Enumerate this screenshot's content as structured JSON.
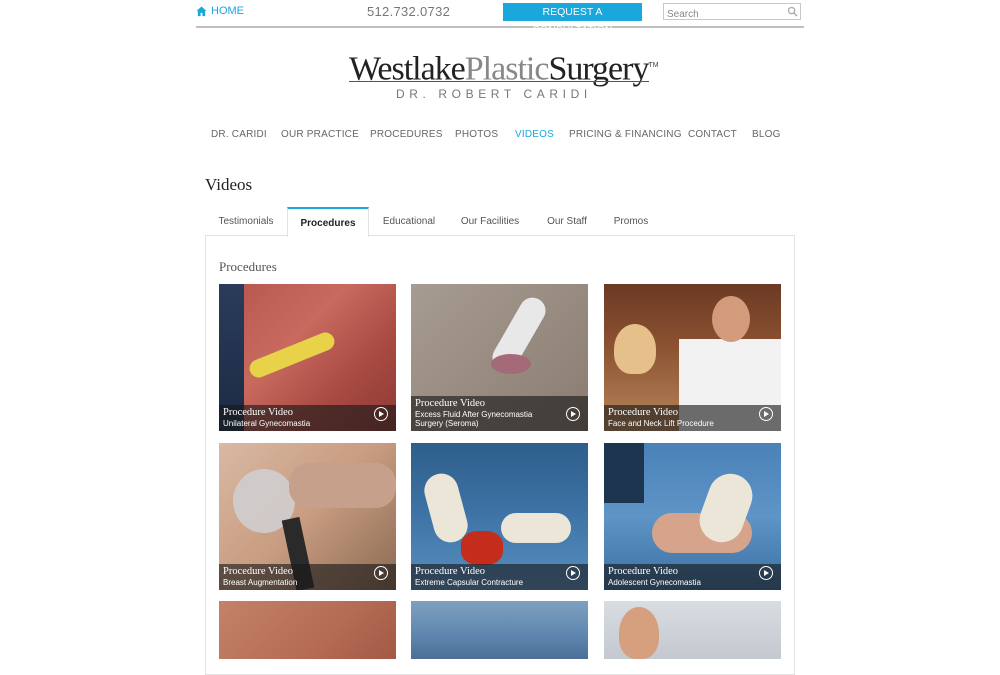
{
  "topbar": {
    "home_label": "HOME",
    "phone": "512.732.0732",
    "cta_label": "REQUEST A CONSULTATION",
    "search_placeholder": "Search"
  },
  "logo": {
    "part1": "Westlake",
    "part2": "Plastic",
    "part3": "Surgery",
    "tm": "TM",
    "subtitle": "DR. ROBERT CARIDI"
  },
  "nav": [
    "DR. CARIDI",
    "OUR PRACTICE",
    "PROCEDURES",
    "PHOTOS",
    "VIDEOS",
    "PRICING & FINANCING",
    "CONTACT",
    "BLOG"
  ],
  "nav_active": "VIDEOS",
  "page_title": "Videos",
  "tabs": [
    "Testimonials",
    "Procedures",
    "Educational",
    "Our Facilities",
    "Our Staff",
    "Promos"
  ],
  "active_tab": "Procedures",
  "panel_title": "Procedures",
  "videos": [
    {
      "type": "Procedure Video",
      "title": "Unilateral Gynecomastia"
    },
    {
      "type": "Procedure Video",
      "title": "Excess Fluid After Gynecomastia Surgery (Seroma)"
    },
    {
      "type": "Procedure Video",
      "title": "Face and Neck Lift Procedure"
    },
    {
      "type": "Procedure Video",
      "title": "Breast Augmentation"
    },
    {
      "type": "Procedure Video",
      "title": "Extreme Capsular Contracture"
    },
    {
      "type": "Procedure Video",
      "title": "Adolescent Gynecomastia"
    }
  ],
  "colors": {
    "accent": "#1aa7dc"
  },
  "icons": {
    "home": "home-icon",
    "search": "search-icon",
    "play": "play-icon"
  }
}
